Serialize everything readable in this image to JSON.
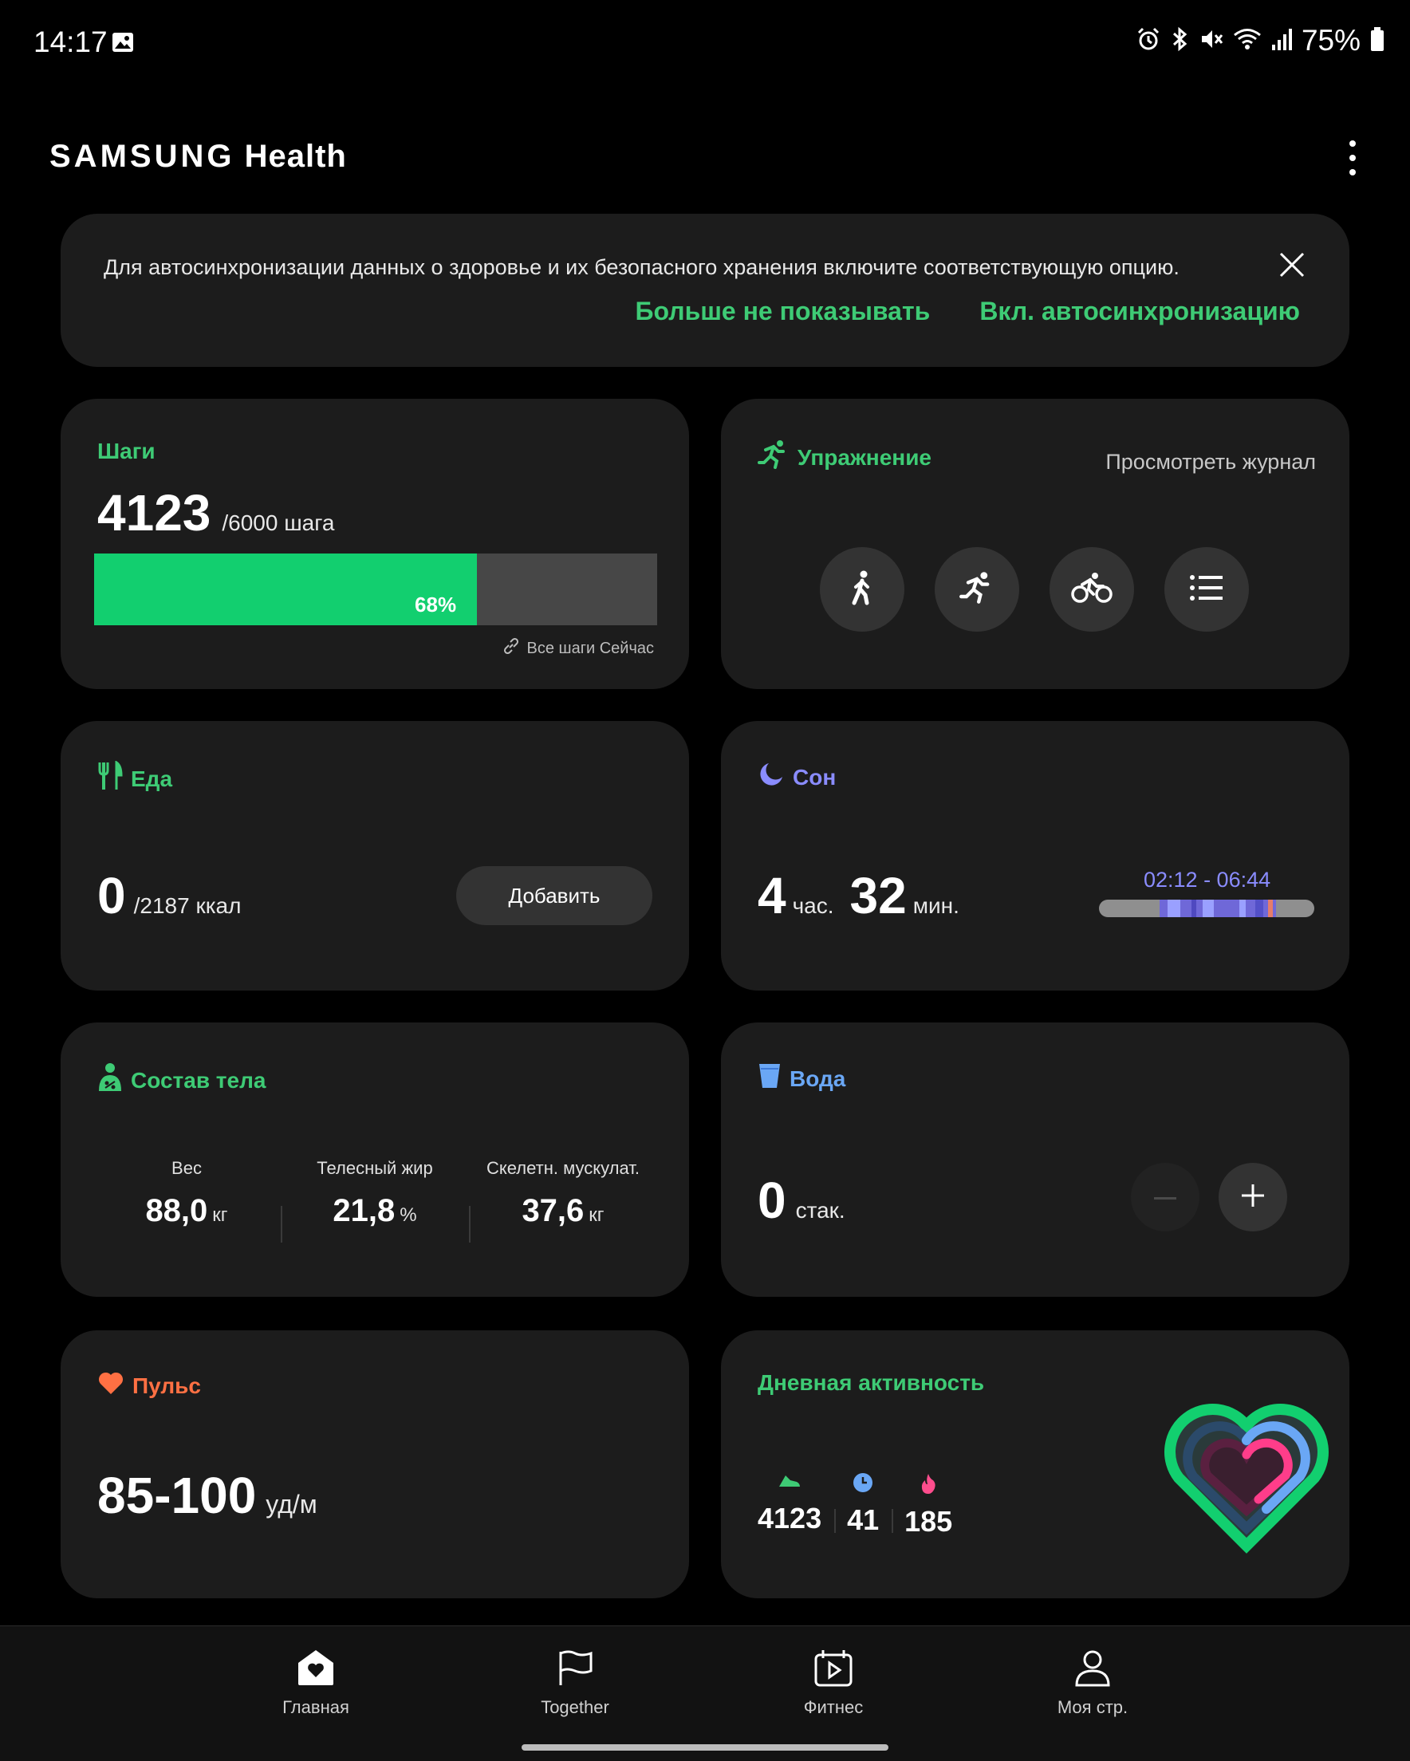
{
  "status_bar": {
    "time": "14:17",
    "battery": "75%",
    "icons": [
      "gallery-icon",
      "alarm-icon",
      "bluetooth-icon",
      "mute-icon",
      "wifi-icon",
      "signal-icon",
      "battery-icon"
    ]
  },
  "header": {
    "brand_samsung": "SAMSUNG",
    "brand_health": "Health",
    "menu_icon": "more-vert-icon"
  },
  "sync_banner": {
    "text": "Для автосинхронизации данных о здоровье и их безопасного хранения включите соответствующую опцию.",
    "dismiss_label": "Больше не показывать",
    "enable_label": "Вкл. автосинхронизацию"
  },
  "steps": {
    "title": "Шаги",
    "value": "4123",
    "goal": "/6000 шага",
    "percent_label": "68%",
    "progress": 0.68,
    "source": "Все шаги Сейчас"
  },
  "exercise": {
    "title": "Упражнение",
    "log_label": "Просмотреть журнал",
    "buttons": [
      "walking-icon",
      "running-icon",
      "cycling-icon",
      "list-icon"
    ]
  },
  "food": {
    "title": "Еда",
    "value": "0",
    "goal": "/2187 ккал",
    "add_label": "Добавить"
  },
  "sleep": {
    "title": "Сон",
    "hours": "4",
    "hours_unit": "час.",
    "minutes": "32",
    "minutes_unit": "мин.",
    "range": "02:12 - 06:44"
  },
  "body": {
    "title": "Состав тела",
    "stats": [
      {
        "label": "Вес",
        "value": "88,0",
        "unit": "кг"
      },
      {
        "label": "Телесный жир",
        "value": "21,8",
        "unit": "%"
      },
      {
        "label": "Скелетн. мускулат.",
        "value": "37,6",
        "unit": "кг"
      }
    ]
  },
  "water": {
    "title": "Вода",
    "value": "0",
    "unit": "стак."
  },
  "pulse": {
    "title": "Пульс",
    "value": "85-100",
    "unit": "уд/м"
  },
  "activity": {
    "title": "Дневная активность",
    "steps": "4123",
    "minutes": "41",
    "calories": "185"
  },
  "nav": {
    "items": [
      {
        "label": "Главная",
        "icon": "home-heart-icon"
      },
      {
        "label": "Together",
        "icon": "flag-icon"
      },
      {
        "label": "Фитнес",
        "icon": "fitness-video-icon"
      },
      {
        "label": "Моя стр.",
        "icon": "profile-icon"
      }
    ]
  },
  "colors": {
    "accent_green": "#3ecb75",
    "progress_green": "#12cf6f",
    "sleep_violet": "#8a8cff",
    "water_blue": "#6aa7f5",
    "pulse_orange": "#ff7043",
    "card_bg": "#1c1c1c"
  }
}
